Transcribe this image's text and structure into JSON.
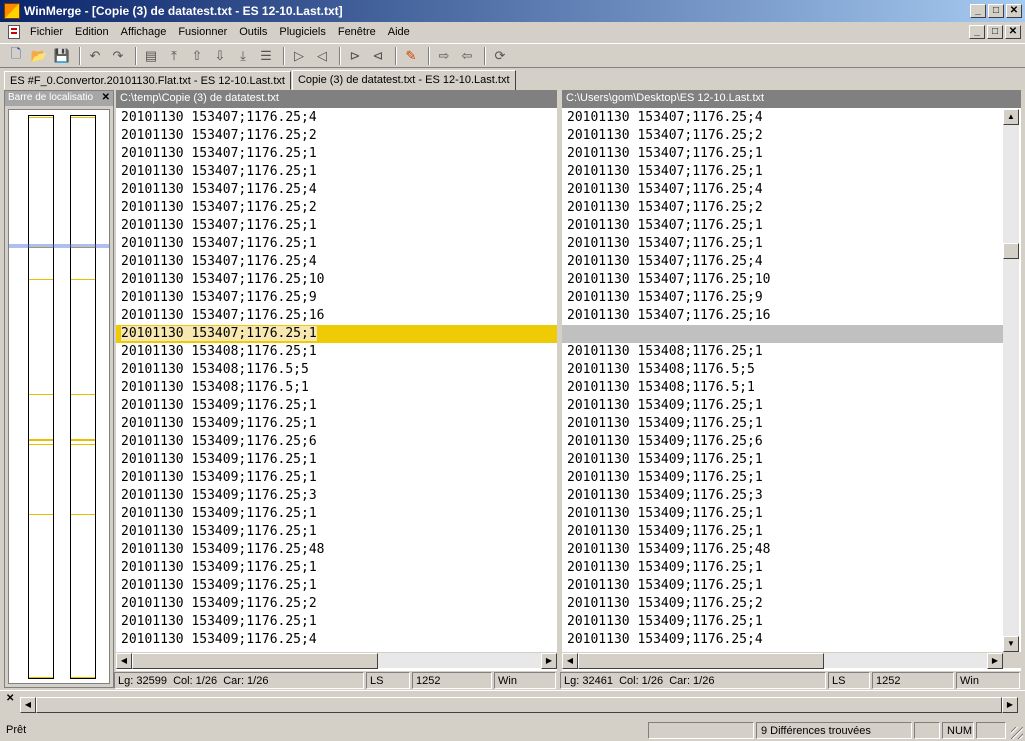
{
  "window": {
    "title": "WinMerge - [Copie (3) de datatest.txt - ES 12-10.Last.txt]",
    "minimize": "_",
    "maximize": "□",
    "close": "✕"
  },
  "menu": [
    "Fichier",
    "Edition",
    "Affichage",
    "Fusionner",
    "Outils",
    "Plugiciels",
    "Fenêtre",
    "Aide"
  ],
  "tabs": [
    {
      "label": "ES #F_0.Convertor.20101130.Flat.txt - ES 12-10.Last.txt",
      "active": false
    },
    {
      "label": "Copie (3) de datatest.txt - ES 12-10.Last.txt",
      "active": true
    }
  ],
  "location_pane": {
    "title": "Barre de localisatio",
    "close": "✕"
  },
  "left_pane": {
    "path": "C:\\temp\\Copie (3) de datatest.txt",
    "lines": [
      "20101130 153407;1176.25;4",
      "20101130 153407;1176.25;2",
      "20101130 153407;1176.25;1",
      "20101130 153407;1176.25;1",
      "20101130 153407;1176.25;4",
      "20101130 153407;1176.25;2",
      "20101130 153407;1176.25;1",
      "20101130 153407;1176.25;1",
      "20101130 153407;1176.25;4",
      "20101130 153407;1176.25;10",
      "20101130 153407;1176.25;9",
      "20101130 153407;1176.25;16",
      "20101130 153407;1176.25;1",
      "20101130 153408;1176.25;1",
      "20101130 153408;1176.5;5",
      "20101130 153408;1176.5;1",
      "20101130 153409;1176.25;1",
      "20101130 153409;1176.25;1",
      "20101130 153409;1176.25;6",
      "20101130 153409;1176.25;1",
      "20101130 153409;1176.25;1",
      "20101130 153409;1176.25;3",
      "20101130 153409;1176.25;1",
      "20101130 153409;1176.25;1",
      "20101130 153409;1176.25;48",
      "20101130 153409;1176.25;1",
      "20101130 153409;1176.25;1",
      "20101130 153409;1176.25;2",
      "20101130 153409;1176.25;1",
      "20101130 153409;1176.25;4"
    ],
    "status": {
      "line": "Lg: 32599",
      "col": "Col: 1/26",
      "char": "Car: 1/26",
      "ls": "LS",
      "codepage": "1252",
      "eol": "Win"
    }
  },
  "right_pane": {
    "path": "C:\\Users\\gom\\Desktop\\ES 12-10.Last.txt",
    "lines": [
      "20101130 153407;1176.25;4",
      "20101130 153407;1176.25;2",
      "20101130 153407;1176.25;1",
      "20101130 153407;1176.25;1",
      "20101130 153407;1176.25;4",
      "20101130 153407;1176.25;2",
      "20101130 153407;1176.25;1",
      "20101130 153407;1176.25;1",
      "20101130 153407;1176.25;4",
      "20101130 153407;1176.25;10",
      "20101130 153407;1176.25;9",
      "20101130 153407;1176.25;16",
      "",
      "20101130 153408;1176.25;1",
      "20101130 153408;1176.5;5",
      "20101130 153408;1176.5;1",
      "20101130 153409;1176.25;1",
      "20101130 153409;1176.25;1",
      "20101130 153409;1176.25;6",
      "20101130 153409;1176.25;1",
      "20101130 153409;1176.25;1",
      "20101130 153409;1176.25;3",
      "20101130 153409;1176.25;1",
      "20101130 153409;1176.25;1",
      "20101130 153409;1176.25;48",
      "20101130 153409;1176.25;1",
      "20101130 153409;1176.25;1",
      "20101130 153409;1176.25;2",
      "20101130 153409;1176.25;1",
      "20101130 153409;1176.25;4"
    ],
    "status": {
      "line": "Lg: 32461",
      "col": "Col: 1/26",
      "char": "Car: 1/26",
      "ls": "LS",
      "codepage": "1252",
      "eol": "Win"
    }
  },
  "diff_line_index": 12,
  "statusbar": {
    "ready": "Prêt",
    "differences": "9 Différences trouvées",
    "num": "NUM"
  },
  "colors": {
    "diff_left": "#efcb05",
    "diff_left_text": "#f6e8b0",
    "diff_right": "#c0c0c0",
    "title_gradient_start": "#0a246a"
  }
}
